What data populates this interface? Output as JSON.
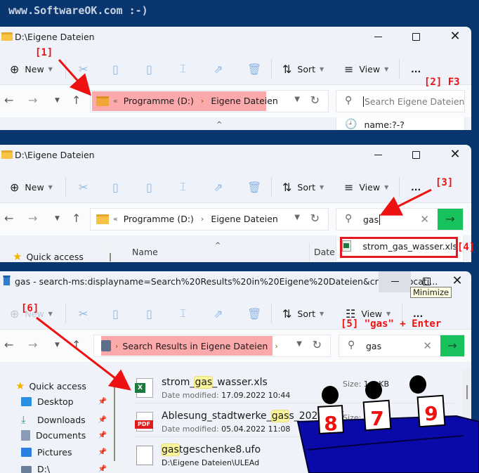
{
  "banner": "www.SoftwareOK.com :-)",
  "watermark": "SoftwareOK.com",
  "window1": {
    "title": "D:\\Eigene Dateien",
    "toolbar": {
      "new_label": "New",
      "sort_label": "Sort",
      "view_label": "View",
      "more_label": "..."
    },
    "address": {
      "overflow": "«",
      "crumbs": [
        "Programme (D:)",
        "Eigene Dateien"
      ]
    },
    "search": {
      "placeholder": "Search Eigene Dateien",
      "value": ""
    },
    "suggestion": "name:?-?",
    "annotations": {
      "step1": "[1]",
      "step2": "[2] F3"
    }
  },
  "window2": {
    "title": "D:\\Eigene Dateien",
    "toolbar": {
      "new_label": "New",
      "sort_label": "Sort",
      "view_label": "View",
      "more_label": "..."
    },
    "address": {
      "overflow": "«",
      "crumbs": [
        "Programme (D:)",
        "Eigene Dateien"
      ]
    },
    "search": {
      "value": "gas"
    },
    "suggestion": "strom_gas_wasser.xls",
    "columns": {
      "name": "Name",
      "date": "Date"
    },
    "quick_access": "Quick access",
    "annotations": {
      "step3": "[3]",
      "step4": "[4]"
    }
  },
  "window3": {
    "title": "gas - search-ms:displayname=Search%20Results%20in%20Eigene%20Dateien&crumb=locati...",
    "tooltip": "Minimize",
    "toolbar": {
      "new_label": "New",
      "sort_label": "Sort",
      "view_label": "View",
      "more_label": "..."
    },
    "address": {
      "crumb": "Search Results in Eigene Dateien"
    },
    "search": {
      "value": "gas"
    },
    "sidebar": {
      "quick_access": "Quick access",
      "items": [
        {
          "label": "Desktop",
          "color": "#2b8fe0"
        },
        {
          "label": "Downloads",
          "color": "#1fa37a"
        },
        {
          "label": "Documents",
          "color": "#8a9bb5"
        },
        {
          "label": "Pictures",
          "color": "#2b7fe0"
        },
        {
          "label": "D:\\",
          "color": "#6b7f99"
        }
      ]
    },
    "files": [
      {
        "pre": "strom_",
        "match": "gas",
        "post": "_wasser.xls",
        "meta_label": "Date modified:",
        "meta_value": "17.09.2022 10:44",
        "size_label": "Size:",
        "size_value": "1__ KB",
        "type": "xls"
      },
      {
        "pre": "Ablesung_stadtwerke_",
        "match": "gas",
        "post": "s_2022.pdf",
        "meta_label": "Date modified:",
        "meta_value": "05.04.2022 11:08",
        "size_label": "Size:",
        "size_value": "6__",
        "type": "pdf"
      },
      {
        "pre": "",
        "match": "gas",
        "post": "tgeschenke8.ufo",
        "meta_label": "",
        "meta_value": "D:\\Eigene Dateien\\ULEAd",
        "size_label": "",
        "size_value": "",
        "type": "file"
      }
    ],
    "annotations": {
      "step5": "[5] \"gas\" + Enter",
      "step6": "[6]"
    }
  },
  "judges": {
    "scores": [
      "8",
      "7",
      "9"
    ]
  },
  "colors": {
    "frame": "#0a3670",
    "annotation": "#ee1111",
    "go_button": "#17c25d",
    "highlight": "#fca9ab",
    "judge_table": "#0a0aa8"
  }
}
